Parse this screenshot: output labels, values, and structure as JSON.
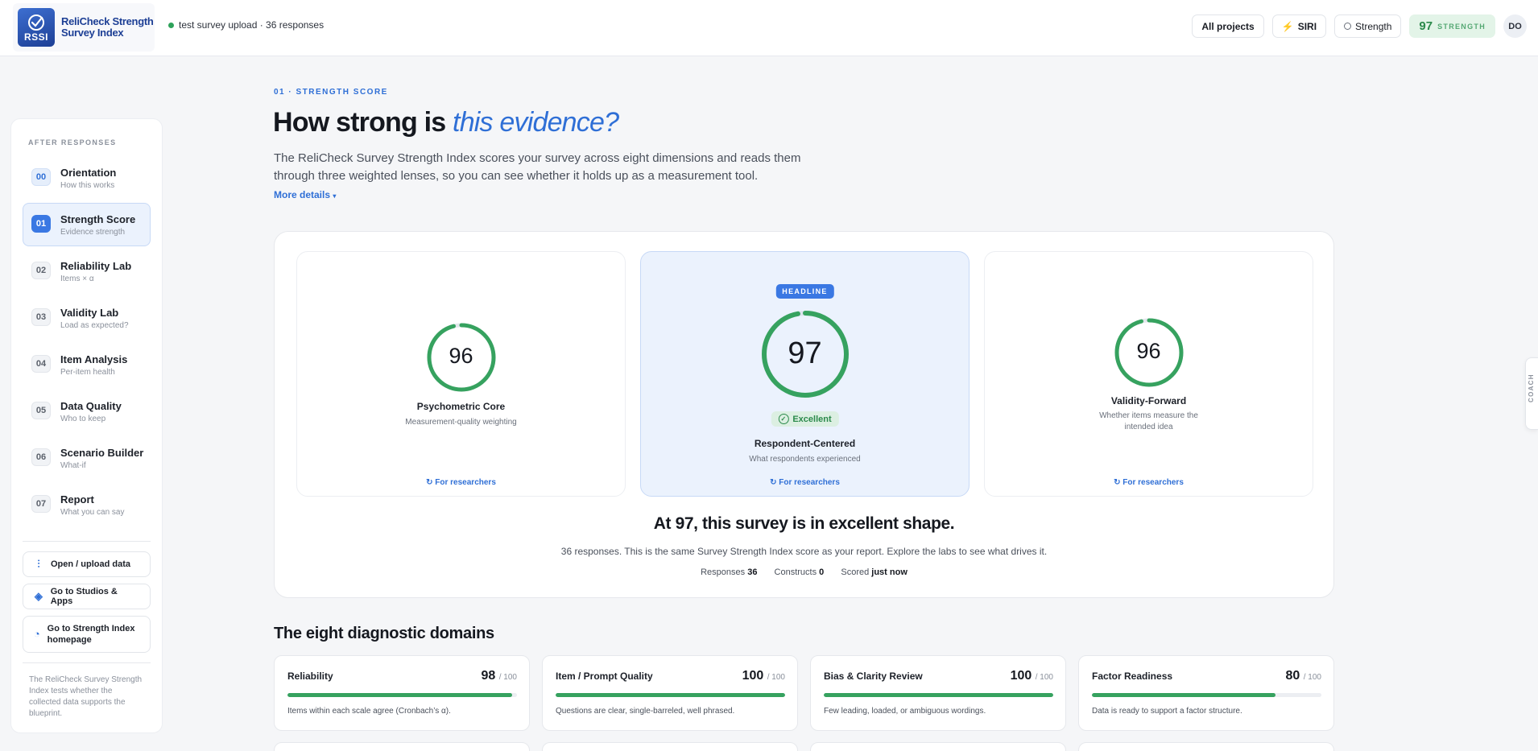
{
  "app": {
    "logo_text": "RSSI",
    "name_line1": "ReliCheck Strength",
    "name_line2": "Survey Index",
    "upload_status": "test survey upload · 36 responses"
  },
  "topbar": {
    "all_projects": "All projects",
    "siri": "SIRI",
    "strength": "Strength",
    "score": "97",
    "score_label": "STRENGTH",
    "avatar": "DO"
  },
  "sidebar": {
    "heading": "AFTER RESPONSES",
    "items": [
      {
        "num": "00",
        "title": "Orientation",
        "sub": "How this works"
      },
      {
        "num": "01",
        "title": "Strength Score",
        "sub": "Evidence strength"
      },
      {
        "num": "02",
        "title": "Reliability Lab",
        "sub": "Items × α"
      },
      {
        "num": "03",
        "title": "Validity Lab",
        "sub": "Load as expected?"
      },
      {
        "num": "04",
        "title": "Item Analysis",
        "sub": "Per-item health"
      },
      {
        "num": "05",
        "title": "Data Quality",
        "sub": "Who to keep"
      },
      {
        "num": "06",
        "title": "Scenario Builder",
        "sub": "What-if"
      },
      {
        "num": "07",
        "title": "Report",
        "sub": "What you can say"
      }
    ],
    "actions": {
      "upload": "Open / upload data",
      "studios": "Go to Studios & Apps",
      "homepage": "Go to Strength Index homepage"
    },
    "note": "The ReliCheck Survey Strength Index tests whether the collected data supports the blueprint."
  },
  "main": {
    "eyebrow": "01 · STRENGTH SCORE",
    "headline_plain": "How strong is ",
    "headline_em": "this evidence?",
    "intro": "The ReliCheck Survey Strength Index scores your survey across eight dimensions and reads them through three weighted lenses, so you can see whether it holds up as a measurement tool.",
    "more_details": "More details",
    "more_caret": "▾"
  },
  "lenses": [
    {
      "score": "96",
      "value": 96,
      "title": "Psychometric Core",
      "sub": "Measurement-quality weighting",
      "link": "For researchers"
    },
    {
      "badge": "HEADLINE",
      "score": "97",
      "value": 97,
      "rating": "Excellent",
      "title": "Respondent-Centered",
      "sub": "What respondents experienced",
      "link": "For researchers"
    },
    {
      "score": "96",
      "value": 96,
      "title": "Validity-Forward",
      "sub": "Whether items measure the intended idea",
      "link": "For researchers"
    }
  ],
  "verdict": {
    "title": "At 97, this survey is in excellent shape.",
    "sub": "36 responses. This is the same Survey Strength Index score as your report. Explore the labs to see what drives it.",
    "responses_label": "Responses",
    "responses": "36",
    "constructs_label": "Constructs",
    "constructs": "0",
    "scored_label": "Scored",
    "scored": "just now"
  },
  "domains": {
    "title": "The eight diagnostic domains",
    "out_of": "/ 100",
    "items": [
      {
        "name": "Reliability",
        "score": "98",
        "value": 98,
        "desc": "Items within each scale agree (Cronbach’s α)."
      },
      {
        "name": "Item / Prompt Quality",
        "score": "100",
        "value": 100,
        "desc": "Questions are clear, single-barreled, well phrased."
      },
      {
        "name": "Bias & Clarity Review",
        "score": "100",
        "value": 100,
        "desc": "Few leading, loaded, or ambiguous wordings."
      },
      {
        "name": "Factor Readiness",
        "score": "80",
        "value": 80,
        "desc": "Data is ready to support a factor structure."
      }
    ]
  },
  "coach": "COACH",
  "colors": {
    "accent": "#2f6fd6",
    "success": "#36a25f",
    "headline_bg": "#ebf2fd"
  }
}
